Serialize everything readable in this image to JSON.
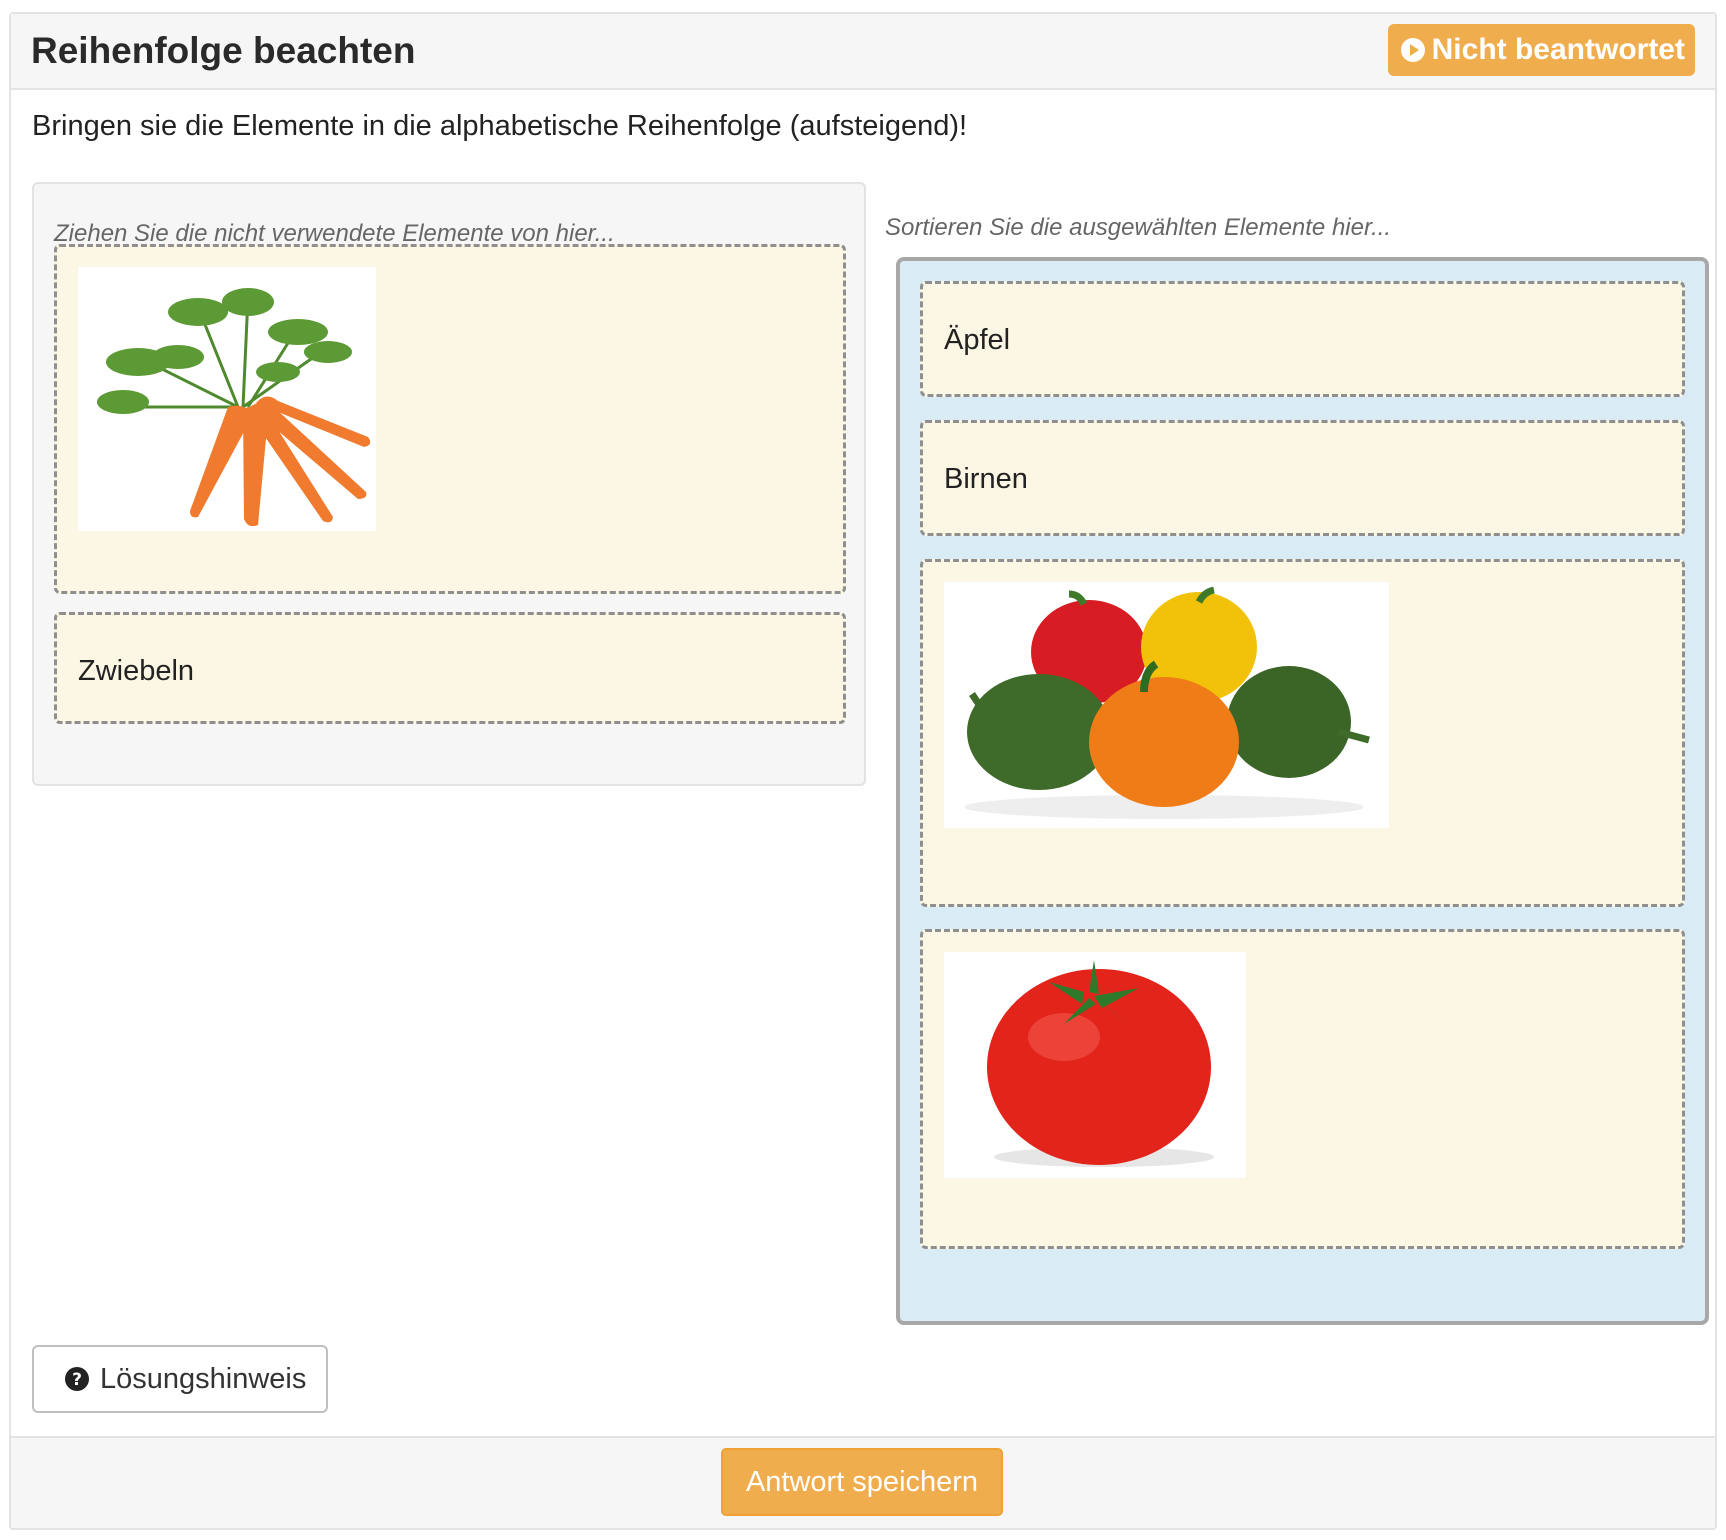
{
  "question": {
    "title": "Reihenfolge beachten",
    "status_label": "Nicht beantwortet",
    "status_icon": "play-circle-icon",
    "instruction": "Bringen sie die Elemente in die alphabetische Reihenfolge (aufsteigend)!"
  },
  "source": {
    "label": "Ziehen Sie die nicht verwendete Elemente von hier...",
    "items": [
      {
        "type": "image",
        "image": "carrots-image"
      },
      {
        "type": "text",
        "text": "Zwiebeln"
      }
    ]
  },
  "target": {
    "label": "Sortieren Sie die ausgewählten Elemente hier...",
    "items": [
      {
        "type": "text",
        "text": "Äpfel"
      },
      {
        "type": "text",
        "text": "Birnen"
      },
      {
        "type": "image",
        "image": "bell-peppers-image"
      },
      {
        "type": "image",
        "image": "tomato-image"
      }
    ]
  },
  "hint_button": {
    "label": "Lösungshinweis",
    "icon": "question-circle-icon"
  },
  "footer": {
    "save_label": "Antwort speichern"
  },
  "colors": {
    "accent": "#f0ad4e",
    "item_background": "#fcf7e4",
    "target_background": "#d9ecf6"
  }
}
